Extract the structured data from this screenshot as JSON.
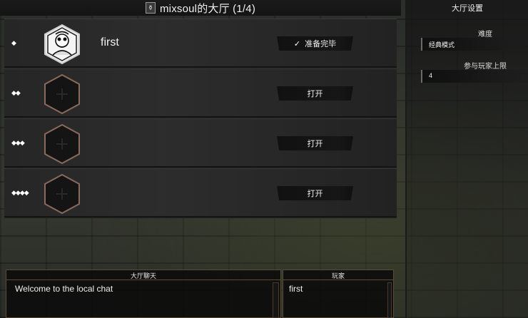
{
  "title": {
    "text": "mixsoul的大厅 (1/4)",
    "icon": "lobby-icon"
  },
  "slots": [
    {
      "rank": "◆",
      "name": "first",
      "button": "准备完毕",
      "checked": true,
      "avatar": "player-avatar"
    },
    {
      "rank": "◆◆",
      "name": "",
      "button": "打开",
      "checked": false,
      "avatar": "empty-slot-cross-icon"
    },
    {
      "rank": "◆◆◆",
      "name": "",
      "button": "打开",
      "checked": false,
      "avatar": "empty-slot-cross-icon"
    },
    {
      "rank": "◆◆◆◆",
      "name": "",
      "button": "打开",
      "checked": false,
      "avatar": "empty-slot-cross-icon"
    }
  ],
  "settings": {
    "header": "大厅设置",
    "difficulty_label": "难度",
    "difficulty_value": "经典模式",
    "max_players_label": "参与玩家上限",
    "max_players_value": "4"
  },
  "chat": {
    "header": "大厅聊天",
    "messages": [
      "Welcome to the local chat"
    ]
  },
  "players": {
    "header": "玩家",
    "list": [
      "first"
    ]
  },
  "colors": {
    "panel_border": "#5a4a36",
    "hex_border": "#8a6a5a"
  }
}
